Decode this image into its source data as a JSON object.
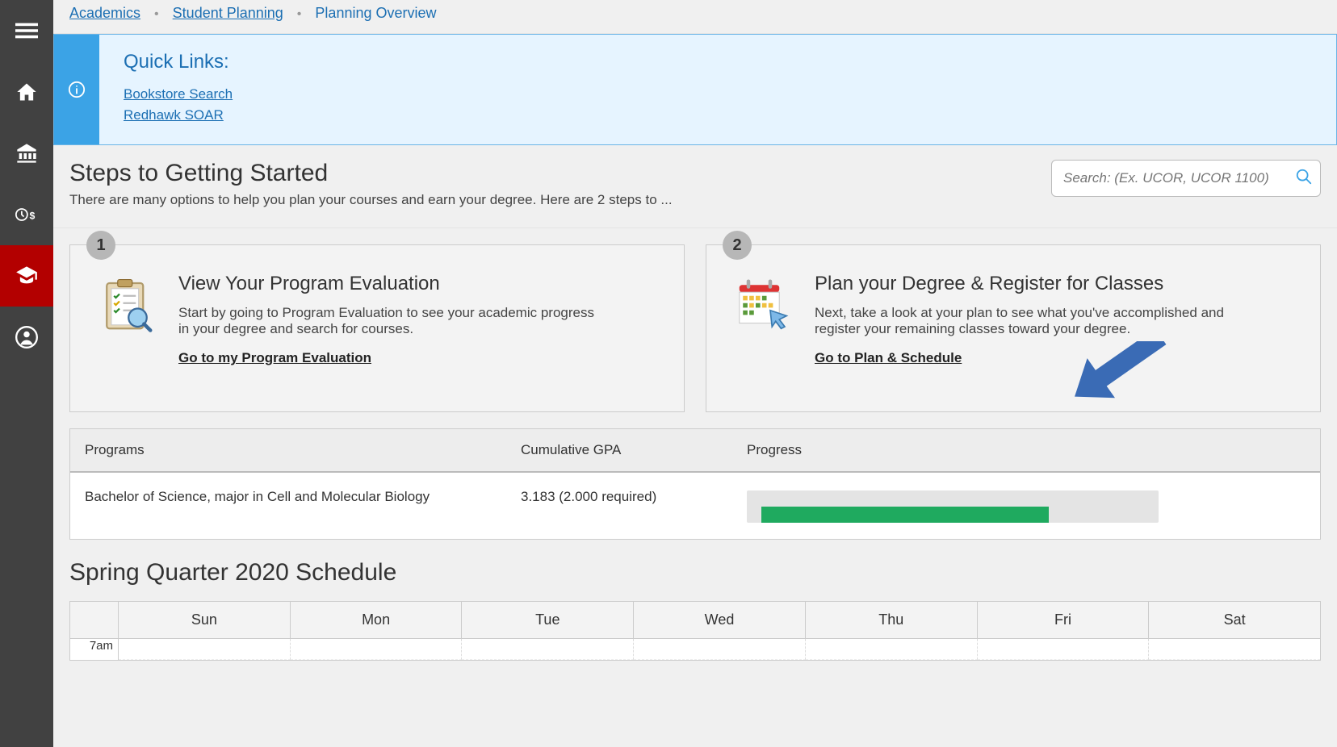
{
  "breadcrumb": {
    "items": [
      "Academics",
      "Student Planning",
      "Planning Overview"
    ]
  },
  "quick_links": {
    "title": "Quick Links:",
    "items": [
      "Bookstore Search",
      "Redhawk SOAR"
    ]
  },
  "getting_started": {
    "title": "Steps to Getting Started",
    "subtitle": "There are many options to help you plan your courses and earn your degree. Here are 2 steps to ..."
  },
  "search": {
    "placeholder": "Search: (Ex. UCOR, UCOR 1100)"
  },
  "cards": [
    {
      "step": "1",
      "title": "View Your Program Evaluation",
      "desc": "Start by going to Program Evaluation to see your academic progress in your degree and search for courses.",
      "link": "Go to my Program Evaluation"
    },
    {
      "step": "2",
      "title": "Plan your Degree & Register for Classes",
      "desc": "Next, take a look at your plan to see what you've accomplished and register your remaining classes toward your degree.",
      "link": "Go to Plan & Schedule"
    }
  ],
  "programs_table": {
    "headers": [
      "Programs",
      "Cumulative GPA",
      "Progress"
    ],
    "row": {
      "program": "Bachelor of Science, major in Cell and Molecular Biology",
      "gpa": "3.183 (2.000 required)",
      "progress_pct": 75
    }
  },
  "schedule": {
    "title": "Spring Quarter 2020 Schedule",
    "days": [
      "Sun",
      "Mon",
      "Tue",
      "Wed",
      "Thu",
      "Fri",
      "Sat"
    ],
    "time_labels": [
      "7am"
    ]
  }
}
